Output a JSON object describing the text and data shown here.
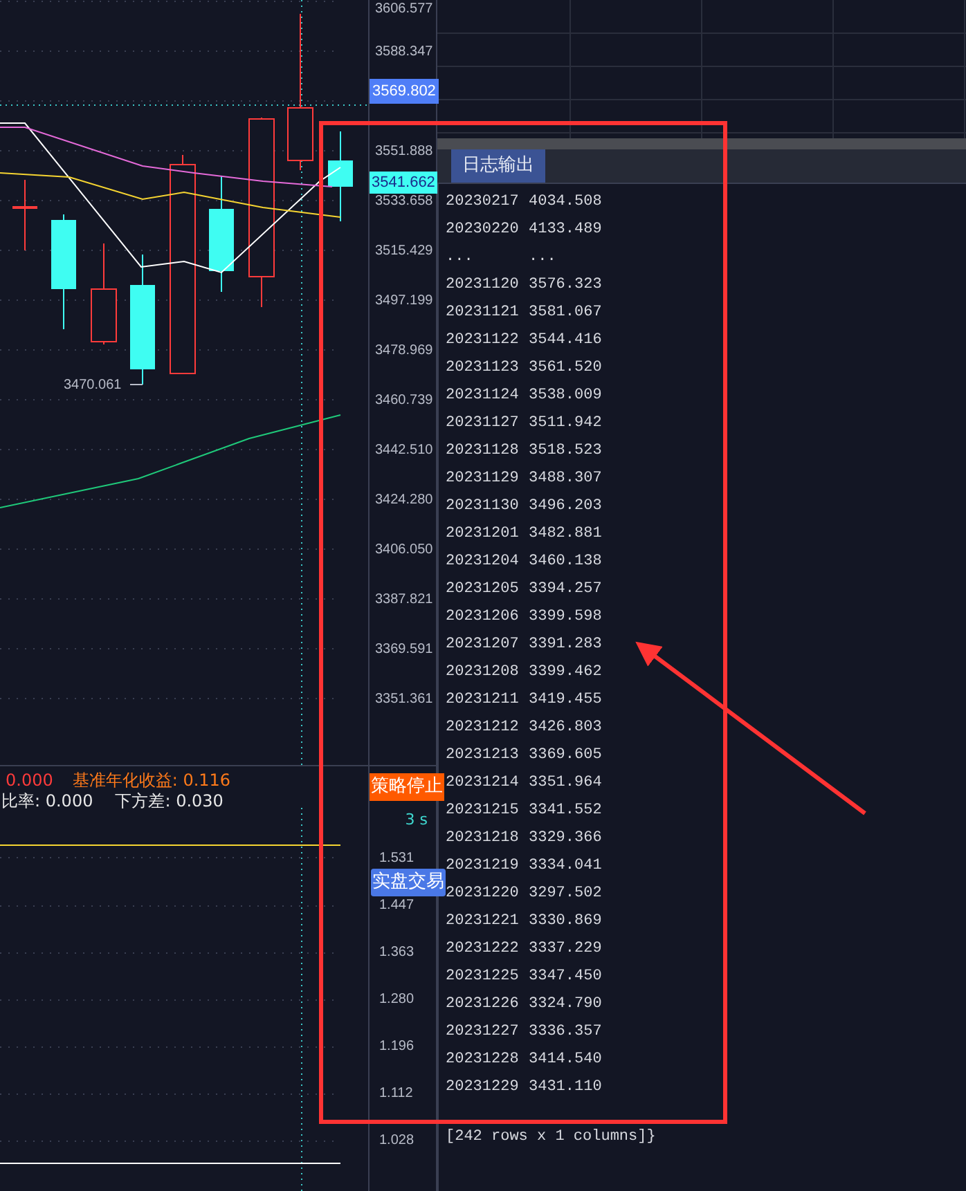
{
  "price_chart": {
    "low_marker": "3470.061"
  },
  "price_axis": {
    "ticks": [
      "3606.577",
      "3588.347",
      "3551.888",
      "3533.658",
      "3515.429",
      "3497.199",
      "3478.969",
      "3460.739",
      "3442.510",
      "3424.280",
      "3406.050",
      "3387.821",
      "3369.591",
      "3351.361"
    ],
    "crosshair_price": "3569.802",
    "last_price": "3541.662"
  },
  "stats": {
    "line_1": [
      {
        "text": "0.000",
        "color": "#ff3b3b"
      },
      {
        "text": "基准年化收益: 0.116",
        "color": "#ff7a1a"
      }
    ],
    "line_2": [
      {
        "text": "比率: 0.000",
        "color": "#e8e8e8"
      },
      {
        "text": "下方差: 0.030",
        "color": "#e8e8e8"
      }
    ]
  },
  "lower_axis": {
    "ticks": [
      "1.531",
      "1.447",
      "1.363",
      "1.280",
      "1.196",
      "1.112",
      "1.028"
    ],
    "stop_button": "策略停止",
    "timer": "3 s",
    "live_button": "实盘交易"
  },
  "log_panel": {
    "tabs": [
      {
        "label": "日志输出",
        "selected": true
      }
    ],
    "rows": [
      [
        "20230217",
        "4034.508"
      ],
      [
        "20230220",
        "4133.489"
      ],
      [
        "...",
        "..."
      ],
      [
        "20231120",
        "3576.323"
      ],
      [
        "20231121",
        "3581.067"
      ],
      [
        "20231122",
        "3544.416"
      ],
      [
        "20231123",
        "3561.520"
      ],
      [
        "20231124",
        "3538.009"
      ],
      [
        "20231127",
        "3511.942"
      ],
      [
        "20231128",
        "3518.523"
      ],
      [
        "20231129",
        "3488.307"
      ],
      [
        "20231130",
        "3496.203"
      ],
      [
        "20231201",
        "3482.881"
      ],
      [
        "20231204",
        "3460.138"
      ],
      [
        "20231205",
        "3394.257"
      ],
      [
        "20231206",
        "3399.598"
      ],
      [
        "20231207",
        "3391.283"
      ],
      [
        "20231208",
        "3399.462"
      ],
      [
        "20231211",
        "3419.455"
      ],
      [
        "20231212",
        "3426.803"
      ],
      [
        "20231213",
        "3369.605"
      ],
      [
        "20231214",
        "3351.964"
      ],
      [
        "20231215",
        "3341.552"
      ],
      [
        "20231218",
        "3329.366"
      ],
      [
        "20231219",
        "3334.041"
      ],
      [
        "20231220",
        "3297.502"
      ],
      [
        "20231221",
        "3330.869"
      ],
      [
        "20231222",
        "3337.229"
      ],
      [
        "20231225",
        "3347.450"
      ],
      [
        "20231226",
        "3324.790"
      ],
      [
        "20231227",
        "3336.357"
      ],
      [
        "20231228",
        "3414.540"
      ],
      [
        "20231229",
        "3431.110"
      ]
    ],
    "footer": "[242 rows x 1 columns]}"
  }
}
